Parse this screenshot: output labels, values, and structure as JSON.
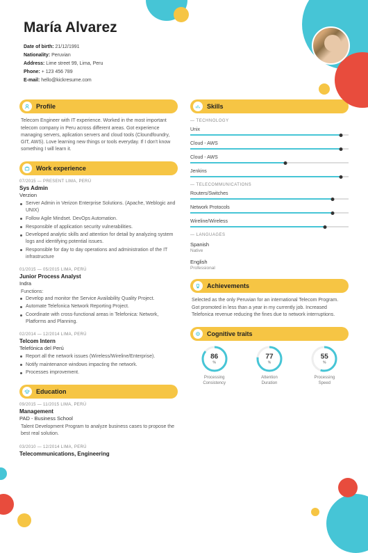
{
  "name": "María Alvarez",
  "details": {
    "dob_label": "Date of birth:",
    "dob": "21/12/1991",
    "nat_label": "Nationality:",
    "nat": "Peruvian",
    "addr_label": "Address:",
    "addr": "Lime street 99, Lima, Peru",
    "phone_label": "Phone:",
    "phone": "+ 123 456 789",
    "email_label": "E-mail:",
    "email": "hello@kickresume.com"
  },
  "sections": {
    "profile": "Profile",
    "work": "Work experience",
    "education": "Education",
    "skills": "Skills",
    "achievements": "Achievements",
    "cognitive": "Cognitive traits"
  },
  "profile_text": "Telecom Engineer with IT experience. Worked in the most important telecom company in Peru across different areas. Got experience managing servers, aplication servers and cloud tools (Cloundfoundry, GIT, AWS). Love learning new things or tools everyday. If I don't know something I will learn it.",
  "jobs": [
    {
      "meta": "07/2015 — PRESENT    LIMA, PERÚ",
      "title": "Sys Admin",
      "company": "Verzion",
      "bullets": [
        "Server Admin in Verizon Enterprise Solutions. (Apache, Weblogic and UNIX)",
        "Follow Agile Mindset. DevOps Automation.",
        "Responsible of application security vulnerabilities.",
        "Developed analytic skills and attention for detail by analyzing system logs and identifying potential issues.",
        "Responsible for day to day operations and administration of the IT infrastructure"
      ]
    },
    {
      "meta": "01/2015 — 05/2015    LIMA, PERÚ",
      "title": "Junior Process Analyst",
      "company": "Indra",
      "intro": "Functions:",
      "bullets": [
        "Develop and monitor the Service Availability Quality Project.",
        "Automate Telefonica Network Reporting Project.",
        "Coordinate with cross-functional areas in Telefonica: Network, Platforms and Planning."
      ]
    },
    {
      "meta": "02/2014 — 12/2014    LIMA, PERÚ",
      "title": "Telcom Intern",
      "company": "Telefónica del Perú",
      "bullets": [
        "Report all the network issues (Wireless/Wireline/Enterprise).",
        "Notify maintenance windows impacting the network.",
        "Processes improvement."
      ]
    }
  ],
  "education": [
    {
      "meta": "09/2015 — 11/2015    LIMA, PERÚ",
      "title": "Management",
      "company": "PAD - Business School",
      "desc": "Talent Development Program to analyze business cases to propose the best real solution."
    },
    {
      "meta": "03/2010 — 12/2014    LIMA, PERÚ",
      "title": "Telecommunications, Engineering"
    }
  ],
  "skill_groups": [
    {
      "label": "— TECHNOLOGY",
      "items": [
        {
          "name": "Unix",
          "pct": 95
        },
        {
          "name": "Cloud - AWS",
          "pct": 95
        },
        {
          "name": "Cloud - AWS",
          "pct": 60
        },
        {
          "name": "Jenkins",
          "pct": 95
        }
      ]
    },
    {
      "label": "— TELECOMMUNICATIONS",
      "items": [
        {
          "name": "Routers/Switches",
          "pct": 90
        },
        {
          "name": "Network Protocols",
          "pct": 90
        },
        {
          "name": "Wireline/Wireless",
          "pct": 85
        }
      ]
    }
  ],
  "lang_label": "— LANGUAGES",
  "languages": [
    {
      "name": "Spanish",
      "level": "Native"
    },
    {
      "name": "English",
      "level": "Professional"
    }
  ],
  "achievements_text": "Selected as the only Peruvian for an international Telecom Program. Got promoted in less than a year in my currently job. Increased Telefonica revenue reducing the fines due to network interruptions.",
  "traits": [
    {
      "val": "86",
      "label1": "Processing",
      "label2": "Consistency"
    },
    {
      "val": "77",
      "label1": "Attention",
      "label2": "Duration"
    },
    {
      "val": "55",
      "label1": "Processing",
      "label2": "Speed"
    }
  ],
  "pct_sym": "%"
}
